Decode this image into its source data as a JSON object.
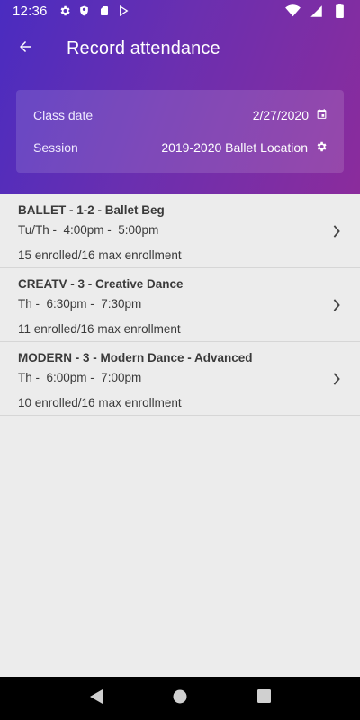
{
  "status_bar": {
    "time": "12:36",
    "icons": [
      "settings-icon",
      "shield-icon",
      "sd-card-icon",
      "play-store-icon",
      "wifi-icon",
      "cell-signal-icon",
      "battery-icon"
    ]
  },
  "app_bar": {
    "title": "Record attendance",
    "back_icon": "arrow-back-icon"
  },
  "filters": {
    "class_date_label": "Class date",
    "class_date_value": "2/27/2020",
    "session_label": "Session",
    "session_value": "2019-2020 Ballet Location"
  },
  "classes": [
    {
      "name": "BALLET - 1-2 - Ballet Beg",
      "schedule": "Tu/Th -  4:00pm -  5:00pm",
      "enrollment": "15 enrolled/16 max enrollment"
    },
    {
      "name": "CREATV - 3 - Creative Dance",
      "schedule": "Th -  6:30pm -  7:30pm",
      "enrollment": "11 enrolled/16 max enrollment"
    },
    {
      "name": "MODERN - 3 - Modern Dance - Advanced",
      "schedule": "Th -  6:00pm -  7:00pm",
      "enrollment": "10 enrolled/16 max enrollment"
    }
  ],
  "colors": {
    "header_gradient_start": "#4a2cc0",
    "header_gradient_end": "#8b2c9c",
    "background": "#ececec",
    "text": "#3a3a3a"
  },
  "nav_bar": {
    "buttons": [
      "back-triangle-icon",
      "home-circle-icon",
      "recents-square-icon"
    ]
  }
}
